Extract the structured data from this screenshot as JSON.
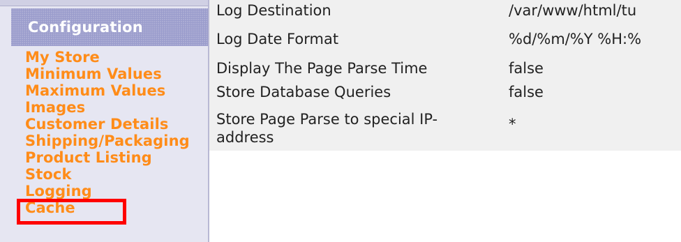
{
  "sidebar": {
    "header": "Configuration",
    "items": [
      {
        "label": "My Store"
      },
      {
        "label": "Minimum Values"
      },
      {
        "label": "Maximum Values"
      },
      {
        "label": "Images"
      },
      {
        "label": "Customer Details"
      },
      {
        "label": "Shipping/Packaging"
      },
      {
        "label": "Product Listing"
      },
      {
        "label": "Stock"
      },
      {
        "label": "Logging"
      },
      {
        "label": "Cache"
      }
    ],
    "highlighted_item": "Logging",
    "highlight_color": "#ff0000",
    "link_color": "#ff8c19"
  },
  "table": {
    "rows": [
      {
        "key": "Log Destination",
        "value": "/var/www/html/tu"
      },
      {
        "key": "Log Date Format",
        "value": "%d/%m/%Y %H:%"
      },
      {
        "key": "Display The Page Parse Time",
        "value": "false"
      },
      {
        "key": "Store Database Queries",
        "value": "false"
      },
      {
        "key": "Store Page Parse to special IP-address",
        "value": "*"
      }
    ]
  }
}
